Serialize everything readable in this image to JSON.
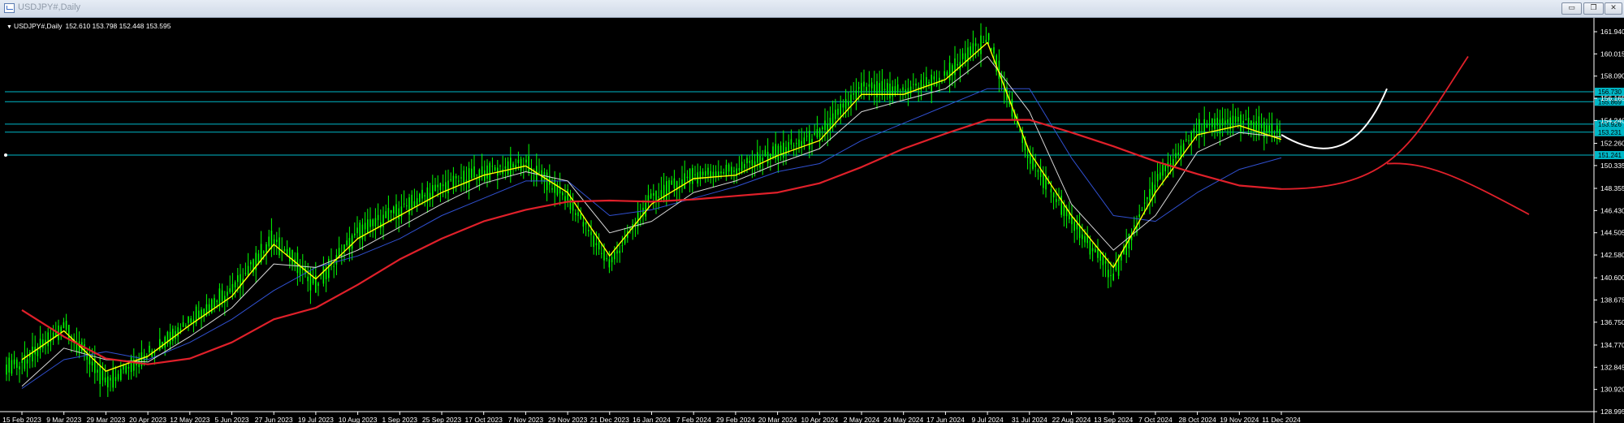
{
  "window": {
    "title": "USDJPY#,Daily",
    "buttons": {
      "minimize": "▭",
      "restore": "❐",
      "close": "✕"
    }
  },
  "header": {
    "symbol": "USDJPY#,Daily",
    "prices": "152.610 153.798 152.448 153.595"
  },
  "colors": {
    "background": "#000000",
    "candle": "#00ff00",
    "fast_ma": "#ffff00",
    "slow_ma": "#d8d8d8",
    "kijun": "#3050d0",
    "trend_ma": "#e0202a",
    "level_line": "#00b8c8",
    "projection_up": "#ffffff",
    "projection_red": "#e0202a",
    "axis": "#ffffff"
  },
  "chart_data": {
    "type": "line",
    "title": "USDJPY#,Daily",
    "ylim": [
      128.995,
      163.0
    ],
    "y_ticks": [
      161.94,
      160.015,
      158.09,
      156.165,
      154.24,
      152.26,
      150.335,
      148.355,
      146.43,
      144.505,
      142.58,
      140.6,
      138.675,
      136.75,
      134.77,
      132.845,
      130.92,
      128.995
    ],
    "x_labels": [
      "15 Feb 2023",
      "9 Mar 2023",
      "29 Mar 2023",
      "20 Apr 2023",
      "12 May 2023",
      "5 Jun 2023",
      "27 Jun 2023",
      "19 Jul 2023",
      "10 Aug 2023",
      "1 Sep 2023",
      "25 Sep 2023",
      "17 Oct 2023",
      "7 Nov 2023",
      "29 Nov 2023",
      "21 Dec 2023",
      "16 Jan 2024",
      "7 Feb 2024",
      "29 Feb 2024",
      "20 Mar 2024",
      "10 Apr 2024",
      "2 May 2024",
      "24 May 2024",
      "17 Jun 2024",
      "9 Jul 2024",
      "31 Jul 2024",
      "22 Aug 2024",
      "13 Sep 2024",
      "7 Oct 2024",
      "28 Oct 2024",
      "19 Nov 2024",
      "11 Dec 2024"
    ],
    "horizontal_levels": [
      {
        "value": 156.73,
        "label": "156.730"
      },
      {
        "value": 155.869,
        "label": "155.869"
      },
      {
        "value": 153.926,
        "label": "153.926"
      },
      {
        "value": 153.231,
        "label": "153.231"
      },
      {
        "value": 151.241,
        "label": "151.241"
      }
    ],
    "series": [
      {
        "name": "USDJPY#",
        "style": "candles",
        "x": [
          "15 Feb 2023",
          "9 Mar 2023",
          "29 Mar 2023",
          "20 Apr 2023",
          "12 May 2023",
          "5 Jun 2023",
          "27 Jun 2023",
          "19 Jul 2023",
          "10 Aug 2023",
          "1 Sep 2023",
          "25 Sep 2023",
          "17 Oct 2023",
          "7 Nov 2023",
          "29 Nov 2023",
          "21 Dec 2023",
          "16 Jan 2024",
          "7 Feb 2024",
          "29 Feb 2024",
          "20 Mar 2024",
          "10 Apr 2024",
          "2 May 2024",
          "24 May 2024",
          "17 Jun 2024",
          "9 Jul 2024",
          "31 Jul 2024",
          "22 Aug 2024",
          "13 Sep 2024",
          "7 Oct 2024",
          "28 Oct 2024",
          "19 Nov 2024",
          "11 Dec 2024"
        ],
        "values": [
          133.0,
          136.5,
          131.5,
          134.0,
          137.0,
          139.5,
          144.0,
          140.0,
          144.5,
          146.5,
          148.5,
          149.8,
          150.5,
          147.5,
          141.8,
          147.5,
          149.5,
          150.0,
          151.5,
          153.0,
          157.0,
          156.8,
          158.0,
          161.5,
          151.0,
          145.5,
          140.8,
          148.8,
          153.5,
          154.2,
          153.0
        ]
      },
      {
        "name": "Fast MA",
        "x": [
          "15 Feb 2023",
          "9 Mar 2023",
          "29 Mar 2023",
          "20 Apr 2023",
          "12 May 2023",
          "5 Jun 2023",
          "27 Jun 2023",
          "19 Jul 2023",
          "10 Aug 2023",
          "1 Sep 2023",
          "25 Sep 2023",
          "17 Oct 2023",
          "7 Nov 2023",
          "29 Nov 2023",
          "21 Dec 2023",
          "16 Jan 2024",
          "7 Feb 2024",
          "29 Feb 2024",
          "20 Mar 2024",
          "10 Apr 2024",
          "2 May 2024",
          "24 May 2024",
          "17 Jun 2024",
          "9 Jul 2024",
          "31 Jul 2024",
          "22 Aug 2024",
          "13 Sep 2024",
          "7 Oct 2024",
          "28 Oct 2024",
          "19 Nov 2024",
          "11 Dec 2024"
        ],
        "values": [
          133.5,
          136.0,
          132.5,
          133.8,
          136.5,
          139.0,
          143.5,
          140.5,
          144.0,
          146.0,
          148.0,
          149.5,
          150.3,
          148.0,
          142.5,
          147.0,
          149.2,
          149.5,
          151.2,
          152.5,
          156.5,
          156.5,
          157.8,
          161.0,
          151.5,
          146.0,
          141.5,
          148.0,
          153.0,
          153.8,
          152.6
        ]
      },
      {
        "name": "Slow MA",
        "x": [
          "15 Feb 2023",
          "9 Mar 2023",
          "29 Mar 2023",
          "20 Apr 2023",
          "12 May 2023",
          "5 Jun 2023",
          "27 Jun 2023",
          "19 Jul 2023",
          "10 Aug 2023",
          "1 Sep 2023",
          "25 Sep 2023",
          "17 Oct 2023",
          "7 Nov 2023",
          "29 Nov 2023",
          "21 Dec 2023",
          "16 Jan 2024",
          "7 Feb 2024",
          "29 Feb 2024",
          "20 Mar 2024",
          "10 Apr 2024",
          "2 May 2024",
          "24 May 2024",
          "17 Jun 2024",
          "9 Jul 2024",
          "31 Jul 2024",
          "22 Aug 2024",
          "13 Sep 2024",
          "7 Oct 2024",
          "28 Oct 2024",
          "19 Nov 2024",
          "11 Dec 2024"
        ],
        "values": [
          131.2,
          134.5,
          133.5,
          133.3,
          135.5,
          138.0,
          141.8,
          141.5,
          143.0,
          145.0,
          147.0,
          148.8,
          149.8,
          149.0,
          144.5,
          145.5,
          148.0,
          149.0,
          150.5,
          151.8,
          155.0,
          156.0,
          157.0,
          159.8,
          155.0,
          147.0,
          143.0,
          146.0,
          151.5,
          153.2,
          152.8
        ]
      },
      {
        "name": "Kijun",
        "x": [
          "15 Feb 2023",
          "9 Mar 2023",
          "29 Mar 2023",
          "20 Apr 2023",
          "12 May 2023",
          "5 Jun 2023",
          "27 Jun 2023",
          "19 Jul 2023",
          "10 Aug 2023",
          "1 Sep 2023",
          "25 Sep 2023",
          "17 Oct 2023",
          "7 Nov 2023",
          "29 Nov 2023",
          "21 Dec 2023",
          "16 Jan 2024",
          "7 Feb 2024",
          "29 Feb 2024",
          "20 Mar 2024",
          "10 Apr 2024",
          "2 May 2024",
          "24 May 2024",
          "17 Jun 2024",
          "9 Jul 2024",
          "31 Jul 2024",
          "22 Aug 2024",
          "13 Sep 2024",
          "7 Oct 2024",
          "28 Oct 2024",
          "19 Nov 2024",
          "11 Dec 2024"
        ],
        "values": [
          131.0,
          133.5,
          134.2,
          133.5,
          135.0,
          137.0,
          139.5,
          141.5,
          142.5,
          144.0,
          146.0,
          147.5,
          149.0,
          149.0,
          146.0,
          146.5,
          147.5,
          148.5,
          149.8,
          150.5,
          152.5,
          154.0,
          155.5,
          157.0,
          157.0,
          151.0,
          146.0,
          145.5,
          148.0,
          150.0,
          151.0
        ]
      },
      {
        "name": "Trend MA",
        "x": [
          "15 Feb 2023",
          "9 Mar 2023",
          "29 Mar 2023",
          "20 Apr 2023",
          "12 May 2023",
          "5 Jun 2023",
          "27 Jun 2023",
          "19 Jul 2023",
          "10 Aug 2023",
          "1 Sep 2023",
          "25 Sep 2023",
          "17 Oct 2023",
          "7 Nov 2023",
          "29 Nov 2023",
          "21 Dec 2023",
          "16 Jan 2024",
          "7 Feb 2024",
          "29 Feb 2024",
          "20 Mar 2024",
          "10 Apr 2024",
          "2 May 2024",
          "24 May 2024",
          "17 Jun 2024",
          "9 Jul 2024",
          "31 Jul 2024",
          "22 Aug 2024",
          "13 Sep 2024",
          "7 Oct 2024",
          "28 Oct 2024",
          "19 Nov 2024",
          "11 Dec 2024"
        ],
        "values": [
          137.8,
          135.5,
          133.6,
          133.1,
          133.6,
          135.0,
          137.0,
          138.0,
          140.0,
          142.2,
          144.0,
          145.5,
          146.5,
          147.2,
          147.3,
          147.2,
          147.4,
          147.7,
          148.0,
          148.8,
          150.2,
          151.8,
          153.1,
          154.3,
          154.3,
          153.2,
          152.0,
          150.7,
          149.6,
          148.6,
          148.3
        ]
      },
      {
        "name": "Projection up",
        "x": [
          "11 Dec 2024"
        ],
        "values": [
          153.0
        ]
      },
      {
        "name": "Projection red",
        "x": [
          "11 Dec 2024"
        ],
        "values": [
          148.3
        ]
      }
    ]
  }
}
